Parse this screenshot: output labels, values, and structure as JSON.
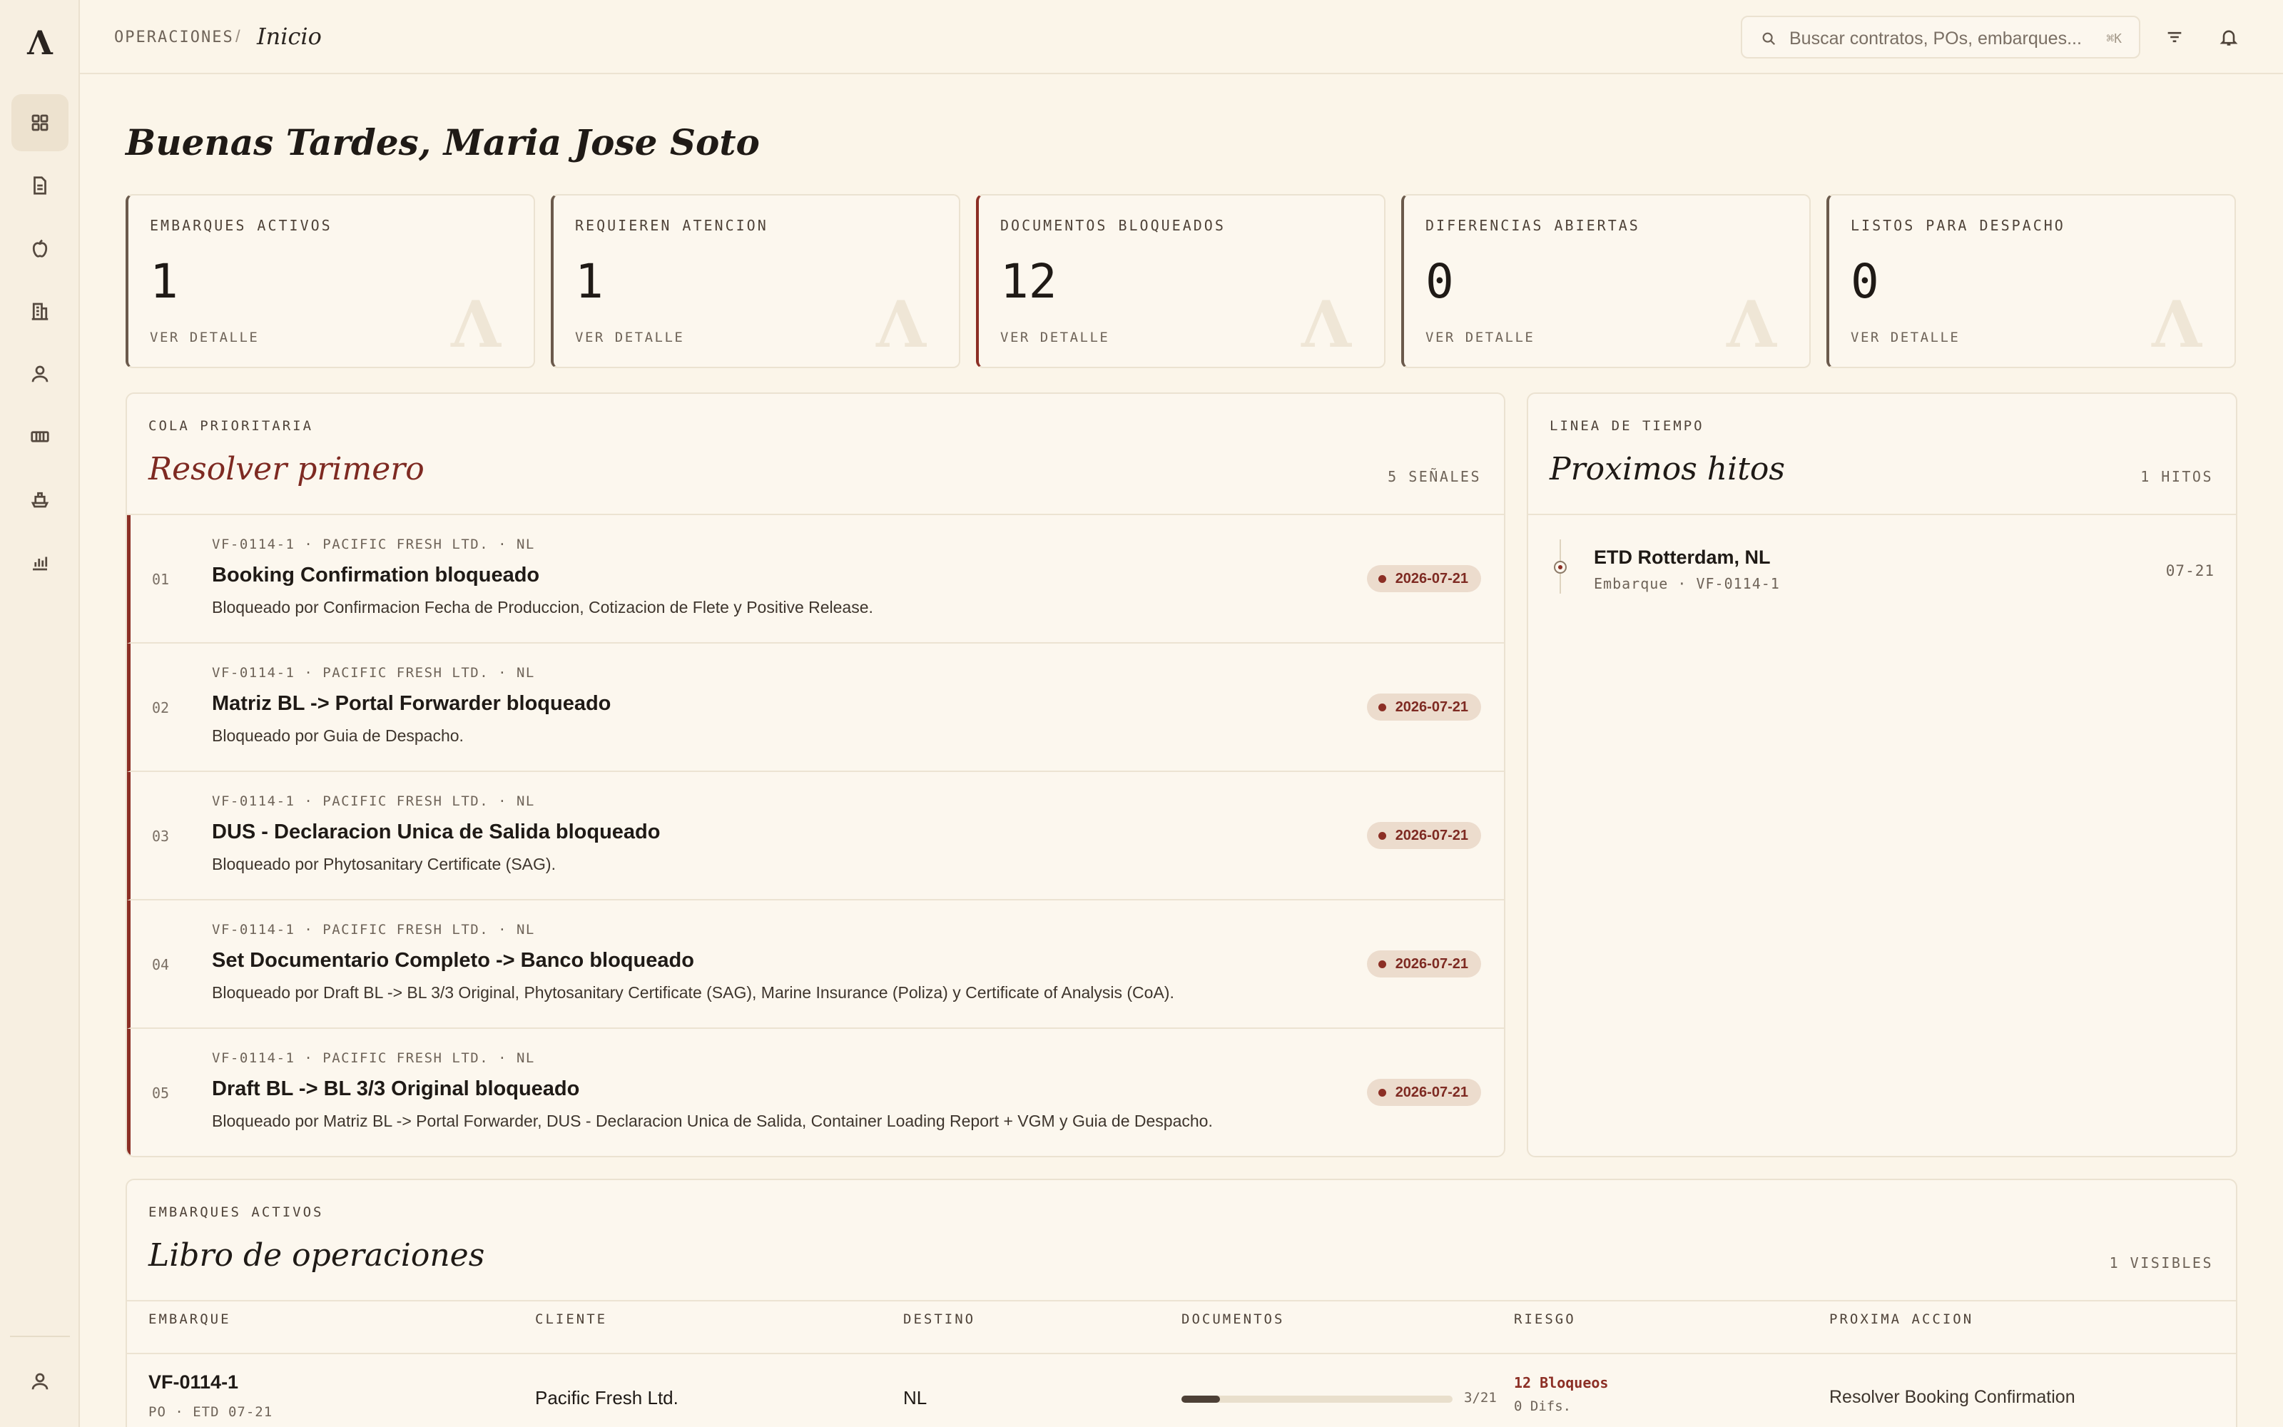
{
  "app": {
    "logo_glyph": "Λ"
  },
  "sidebar": {
    "items": [
      {
        "icon": "grid-icon",
        "active": true
      },
      {
        "icon": "document-icon",
        "active": false
      },
      {
        "icon": "apple-icon",
        "active": false
      },
      {
        "icon": "building-icon",
        "active": false
      },
      {
        "icon": "user-icon",
        "active": false
      },
      {
        "icon": "container-icon",
        "active": false
      },
      {
        "icon": "ship-icon",
        "active": false
      },
      {
        "icon": "bar-chart-icon",
        "active": false
      }
    ],
    "footer_icon": "user-icon"
  },
  "topbar": {
    "breadcrumb_root": "OPERACIONES",
    "breadcrumb_sep": "/",
    "breadcrumb_current": "Inicio",
    "search_placeholder": "Buscar contratos, POs, embarques...",
    "search_shortcut": "⌘K",
    "filter_icon": "filter-icon",
    "bell_icon": "bell-icon"
  },
  "greeting": "Buenas Tardes, Maria Jose Soto",
  "kpis": [
    {
      "label": "EMBARQUES ACTIVOS",
      "value": "1",
      "link": "VER DETALLE",
      "mark": "Λ"
    },
    {
      "label": "REQUIEREN ATENCION",
      "value": "1",
      "link": "VER DETALLE",
      "mark": "Λ"
    },
    {
      "label": "DOCUMENTOS BLOQUEADOS",
      "value": "12",
      "link": "VER DETALLE",
      "mark": "Λ"
    },
    {
      "label": "DIFERENCIAS ABIERTAS",
      "value": "0",
      "link": "VER DETALLE",
      "mark": "Λ"
    },
    {
      "label": "LISTOS PARA DESPACHO",
      "value": "0",
      "link": "VER DETALLE",
      "mark": "Λ"
    }
  ],
  "queue": {
    "eyebrow": "COLA PRIORITARIA",
    "title": "Resolver primero",
    "count": "5 SEÑALES",
    "items": [
      {
        "num": "01",
        "meta": "VF-0114-1 · PACIFIC FRESH LTD. · NL",
        "title": "Booking Confirmation bloqueado",
        "desc": "Bloqueado por Confirmacion Fecha de Produccion, Cotizacion de Flete y Positive Release.",
        "date": "2026-07-21"
      },
      {
        "num": "02",
        "meta": "VF-0114-1 · PACIFIC FRESH LTD. · NL",
        "title": "Matriz BL -> Portal Forwarder bloqueado",
        "desc": "Bloqueado por Guia de Despacho.",
        "date": "2026-07-21"
      },
      {
        "num": "03",
        "meta": "VF-0114-1 · PACIFIC FRESH LTD. · NL",
        "title": "DUS - Declaracion Unica de Salida bloqueado",
        "desc": "Bloqueado por Phytosanitary Certificate (SAG).",
        "date": "2026-07-21"
      },
      {
        "num": "04",
        "meta": "VF-0114-1 · PACIFIC FRESH LTD. · NL",
        "title": "Set Documentario Completo -> Banco bloqueado",
        "desc": "Bloqueado por Draft BL -> BL 3/3 Original, Phytosanitary Certificate (SAG), Marine Insurance (Poliza) y Certificate of Analysis (CoA).",
        "date": "2026-07-21"
      },
      {
        "num": "05",
        "meta": "VF-0114-1 · PACIFIC FRESH LTD. · NL",
        "title": "Draft BL -> BL 3/3 Original bloqueado",
        "desc": "Bloqueado por Matriz BL -> Portal Forwarder, DUS - Declaracion Unica de Salida, Container Loading Report + VGM y Guia de Despacho.",
        "date": "2026-07-21"
      }
    ]
  },
  "timeline": {
    "eyebrow": "LINEA DE TIEMPO",
    "title": "Proximos hitos",
    "count": "1 HITOS",
    "items": [
      {
        "title": "ETD Rotterdam, NL",
        "sub": "Embarque · VF-0114-1",
        "date": "07-21"
      }
    ]
  },
  "ledger": {
    "eyebrow": "EMBARQUES ACTIVOS",
    "title": "Libro de operaciones",
    "count": "1 VISIBLES",
    "columns": [
      "EMBARQUE",
      "CLIENTE",
      "DESTINO",
      "DOCUMENTOS",
      "RIESGO",
      "PROXIMA ACCION"
    ],
    "rows": [
      {
        "id": "VF-0114-1",
        "sub": "PO · ETD 07-21",
        "client": "Pacific Fresh Ltd.",
        "dest": "NL",
        "docs_label": "3/21",
        "docs_fraction": 0.143,
        "risk": "12 Bloqueos",
        "risk_sub": "0 Difs.",
        "next": "Resolver Booking Confirmation"
      }
    ]
  },
  "colors": {
    "accent": "#8c2f25",
    "background": "#fbf5e9",
    "card": "#fcf7ee"
  }
}
